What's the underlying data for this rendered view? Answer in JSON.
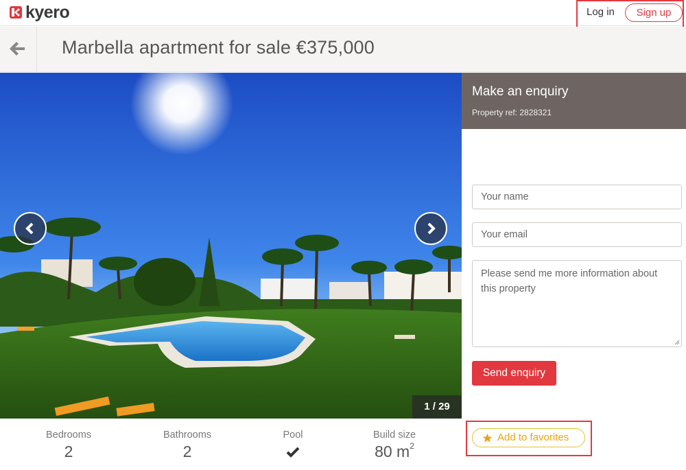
{
  "header": {
    "logo_text": "kyero",
    "login_label": "Log in",
    "signup_label": "Sign up",
    "accent_color": "#e2383f"
  },
  "title_bar": {
    "back_icon": "arrow-left-icon",
    "title": "Marbella apartment for sale €375,000"
  },
  "gallery": {
    "counter": "1 / 29",
    "prev_icon": "chevron-left-icon",
    "next_icon": "chevron-right-icon"
  },
  "enquiry": {
    "title": "Make an enquiry",
    "property_ref": "Property ref: 2828321",
    "name_placeholder": "Your name",
    "email_placeholder": "Your email",
    "message_value": "Please send me more information about this property",
    "send_label": "Send enquiry"
  },
  "stats": {
    "bedrooms_label": "Bedrooms",
    "bedrooms_value": "2",
    "bathrooms_label": "Bathrooms",
    "bathrooms_value": "2",
    "pool_label": "Pool",
    "pool_icon": "check-icon",
    "size_label": "Build size",
    "size_value": "80 m",
    "size_unit_sup": "2"
  },
  "favorites": {
    "label": "Add to favorites",
    "icon": "star-icon",
    "color": "#e8a40c"
  }
}
